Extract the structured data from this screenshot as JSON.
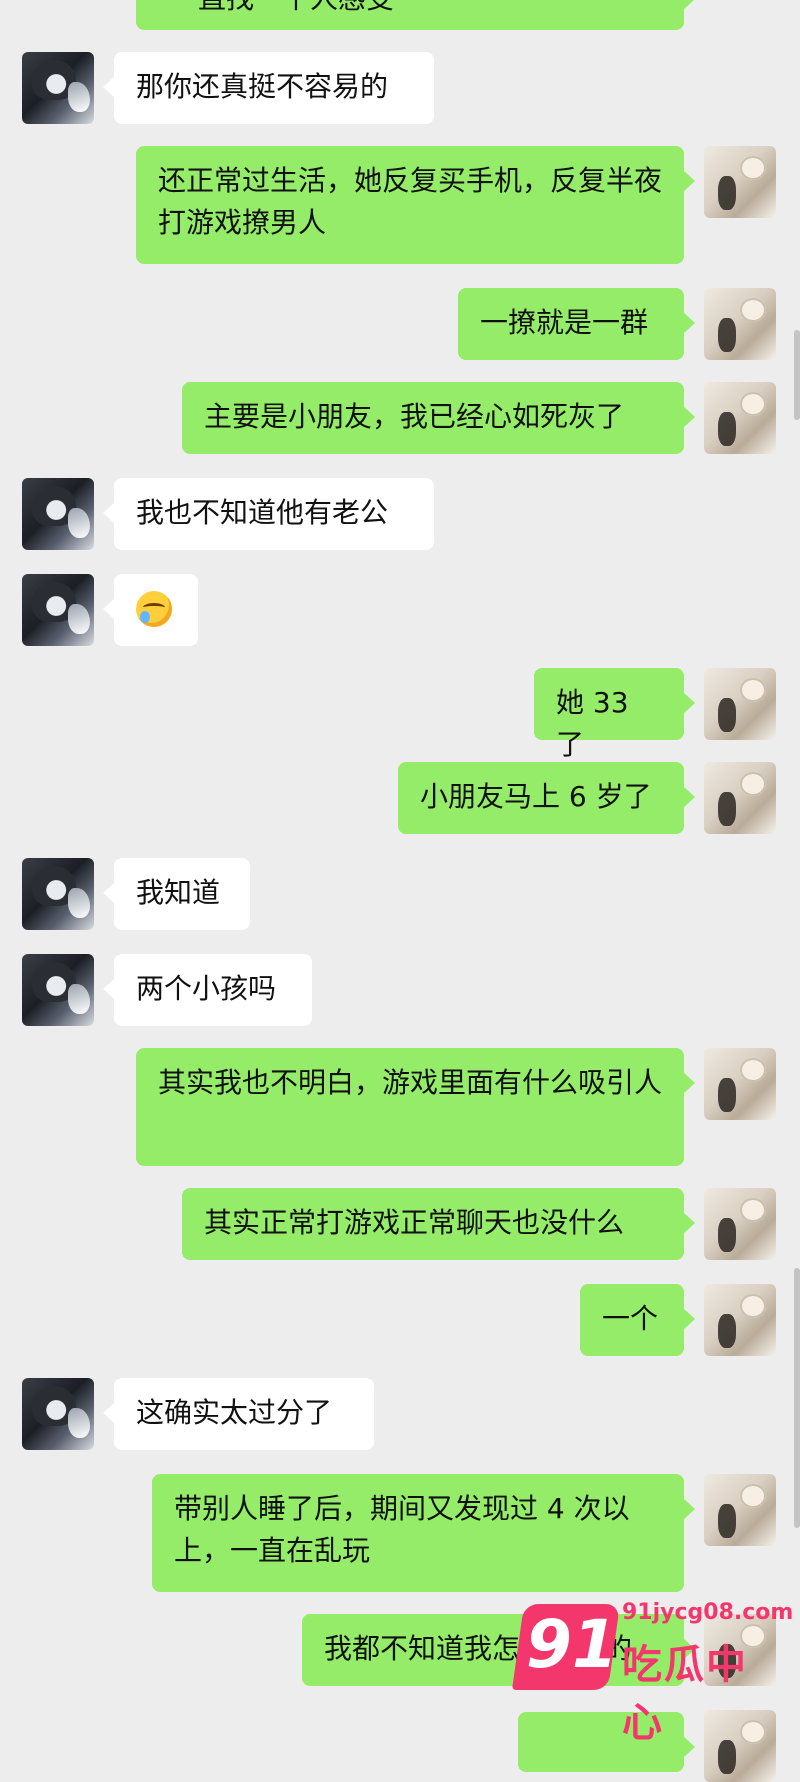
{
  "messages": [
    {
      "side": "out",
      "text": "一直找一个人感受",
      "cropped": true
    },
    {
      "side": "in",
      "text": "那你还真挺不容易的"
    },
    {
      "side": "out",
      "text": "还正常过生活，她反复买手机，反复半夜打游戏撩男人"
    },
    {
      "side": "out",
      "text": "一撩就是一群"
    },
    {
      "side": "out",
      "text": "主要是小朋友，我已经心如死灰了"
    },
    {
      "side": "in",
      "text": "我也不知道他有老公"
    },
    {
      "side": "in",
      "emoji": "sweat-laugh-emoji"
    },
    {
      "side": "out",
      "text": "她 33 了"
    },
    {
      "side": "out",
      "text": "小朋友马上 6 岁了"
    },
    {
      "side": "in",
      "text": "我知道"
    },
    {
      "side": "in",
      "text": "两个小孩吗"
    },
    {
      "side": "out",
      "text": "其实我也不明白，游戏里面有什么吸引人"
    },
    {
      "side": "out",
      "text": "其实正常打游戏正常聊天也没什么"
    },
    {
      "side": "out",
      "text": "一个"
    },
    {
      "side": "in",
      "text": "这确实太过分了"
    },
    {
      "side": "out",
      "text": "带别人睡了后，期间又发现过 4 次以上，一直在乱玩"
    },
    {
      "side": "out",
      "text": "我都不知道我怎么过来的"
    }
  ],
  "watermark": {
    "number": "91",
    "url": "91jycg08.com",
    "name": "吃瓜中心"
  },
  "colors": {
    "background": "#ededed",
    "incoming": "#ffffff",
    "outgoing": "#95ec69",
    "watermark": "#f3376c"
  }
}
